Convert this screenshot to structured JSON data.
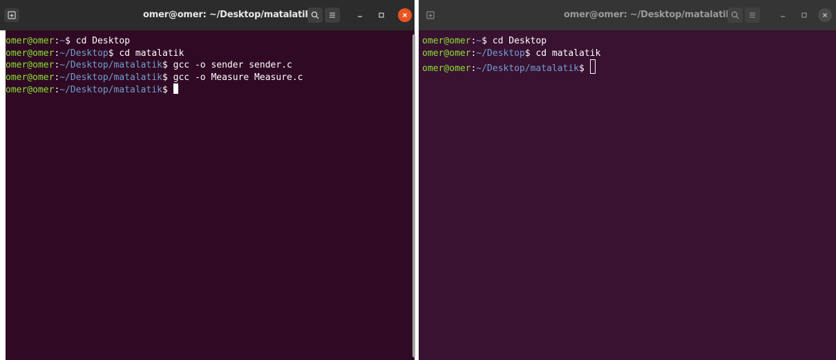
{
  "left_terminal": {
    "title": "omer@omer: ~/Desktop/matalatik",
    "icons": {
      "new_tab": "new-tab-icon",
      "search": "search-icon",
      "menu": "hamburger-menu-icon",
      "minimize": "minimize-icon",
      "maximize": "maximize-icon",
      "close": "close-icon"
    },
    "lines": [
      {
        "user": "omer@omer",
        "sep": ":",
        "path": "~",
        "dollar": "$",
        "cmd": " cd Desktop"
      },
      {
        "user": "omer@omer",
        "sep": ":",
        "path": "~/Desktop",
        "dollar": "$",
        "cmd": " cd matalatik"
      },
      {
        "user": "omer@omer",
        "sep": ":",
        "path": "~/Desktop/matalatik",
        "dollar": "$",
        "cmd": " gcc -o sender sender.c"
      },
      {
        "user": "omer@omer",
        "sep": ":",
        "path": "~/Desktop/matalatik",
        "dollar": "$",
        "cmd": " gcc -o Measure Measure.c"
      },
      {
        "user": "omer@omer",
        "sep": ":",
        "path": "~/Desktop/matalatik",
        "dollar": "$",
        "cmd": " "
      }
    ]
  },
  "right_terminal": {
    "title": "omer@omer: ~/Desktop/matalatik",
    "lines": [
      {
        "user": "omer@omer",
        "sep": ":",
        "path": "~",
        "dollar": "$",
        "cmd": " cd Desktop"
      },
      {
        "user": "omer@omer",
        "sep": ":",
        "path": "~/Desktop",
        "dollar": "$",
        "cmd": " cd matalatik"
      },
      {
        "user": "omer@omer",
        "sep": ":",
        "path": "~/Desktop/matalatik",
        "dollar": "$",
        "cmd": " "
      }
    ]
  },
  "colors": {
    "terminal_bg": "#300a24",
    "user_green": "#8ae234",
    "path_blue": "#729fcf",
    "close_orange": "#e95420"
  }
}
